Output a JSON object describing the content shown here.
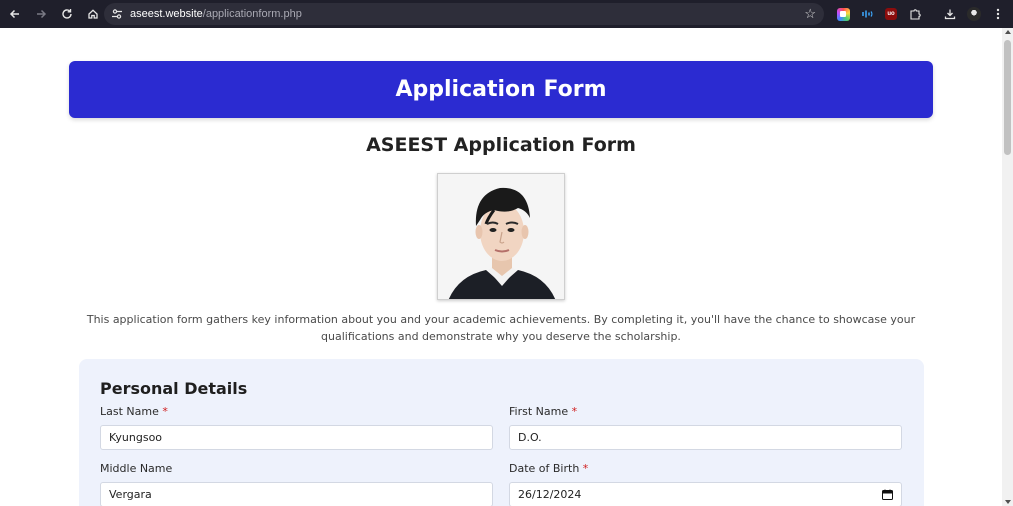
{
  "browser": {
    "url_host": "aseest.website",
    "url_path": "/applicationform.php"
  },
  "banner": {
    "title": "Application Form"
  },
  "form": {
    "heading": "ASEEST Application Form",
    "intro": "This application form gathers key information about you and your academic achievements. By completing it, you'll have the chance to showcase your qualifications and demonstrate why you deserve the scholarship."
  },
  "personal": {
    "section_title": "Personal Details",
    "required_mark": "*",
    "last_name": {
      "label": "Last Name",
      "value": "Kyungsoo"
    },
    "first_name": {
      "label": "First Name",
      "value": "D.O."
    },
    "middle_name": {
      "label": "Middle Name",
      "value": "Vergara"
    },
    "dob": {
      "label": "Date of Birth",
      "value": "26/12/2024"
    }
  },
  "colors": {
    "banner": "#2b2bd1",
    "card": "#eef2fc",
    "required": "#d01c1c"
  }
}
